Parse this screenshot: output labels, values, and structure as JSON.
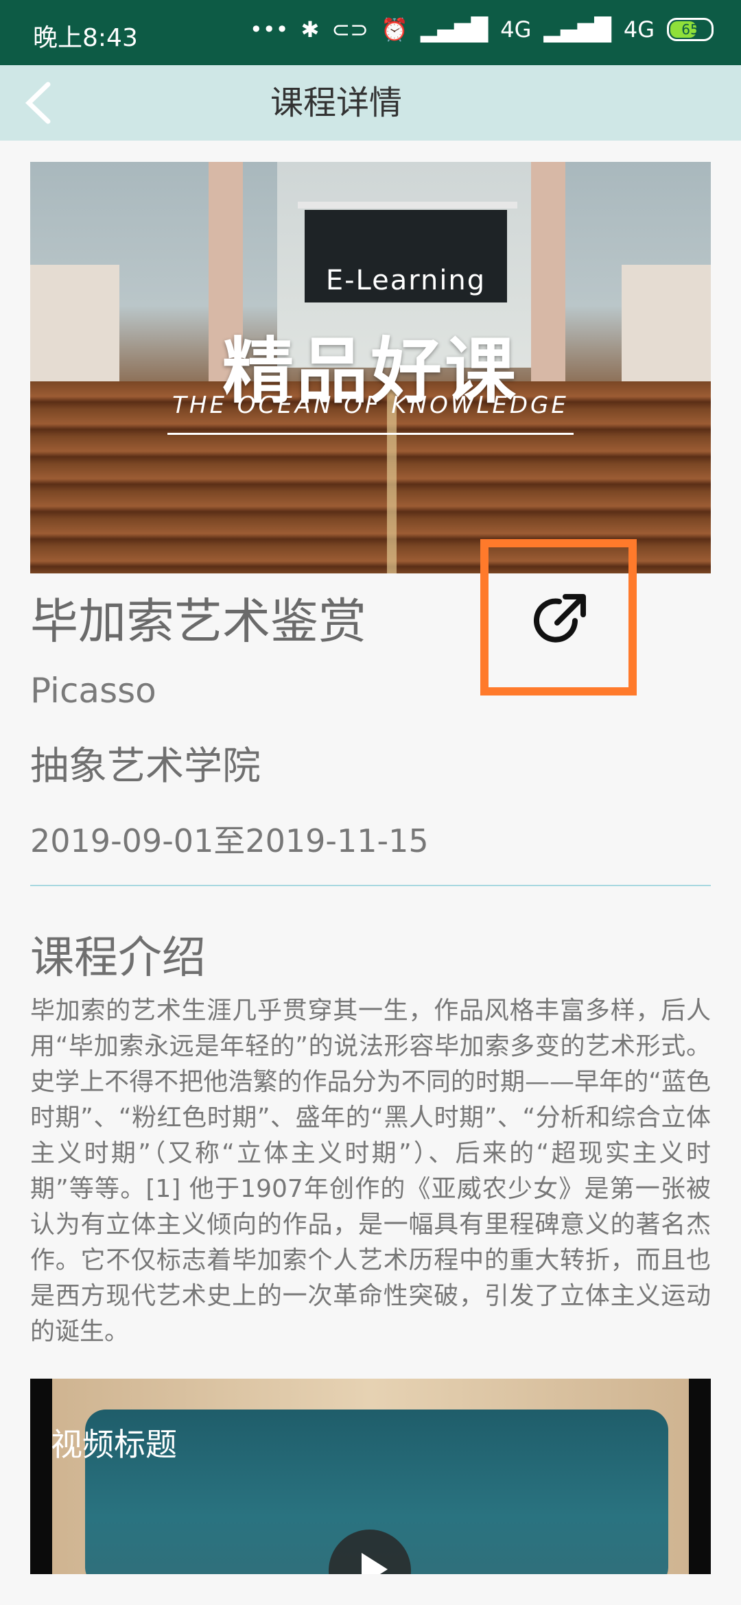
{
  "status_bar": {
    "time": "晚上8:43",
    "icons": [
      "more-icon",
      "bluetooth-icon",
      "nfc-icon",
      "alarm-icon",
      "signal-icon",
      "signal-hd-icon"
    ],
    "network1": "4G",
    "network2": "4G",
    "battery": "65"
  },
  "header": {
    "title": "课程详情",
    "back_icon": "chevron-left-icon"
  },
  "banner": {
    "board_text": "E-Learning",
    "headline": "精品好课",
    "subline": "THE OCEAN OF KNOWLEDGE"
  },
  "course": {
    "name": "毕加索艺术鉴赏",
    "share_icon": "share-icon",
    "teacher": "Picasso",
    "college": "抽象艺术学院",
    "dates": "2019-09-01至2019-11-15"
  },
  "intro": {
    "title": "课程介绍",
    "text": "毕加索的艺术生涯几乎贯穿其一生，作品风格丰富多样，后人用“毕加索永远是年轻的”的说法形容毕加索多变的艺术形式。史学上不得不把他浩繁的作品分为不同的时期——早年的“蓝色时期”、“粉红色时期”、盛年的“黑人时期”、“分析和综合立体主义时期”（又称“立体主义时期”）、后来的“超现实主义时期”等等。[1] 他于1907年创作的《亚威农少女》是第一张被认为有立体主义倾向的作品，是一幅具有里程碑意义的著名杰作。它不仅标志着毕加索个人艺术历程中的重大转折，而且也是西方现代艺术史上的一次革命性突破，引发了立体主义运动的诞生。"
  },
  "video": {
    "title": "视频标题",
    "play_icon": "play-icon"
  },
  "colors": {
    "status_bar": "#0d5b45",
    "header_bg": "#cfe7e6",
    "highlight": "#ff7a2b",
    "divider": "#a8d8e0"
  }
}
